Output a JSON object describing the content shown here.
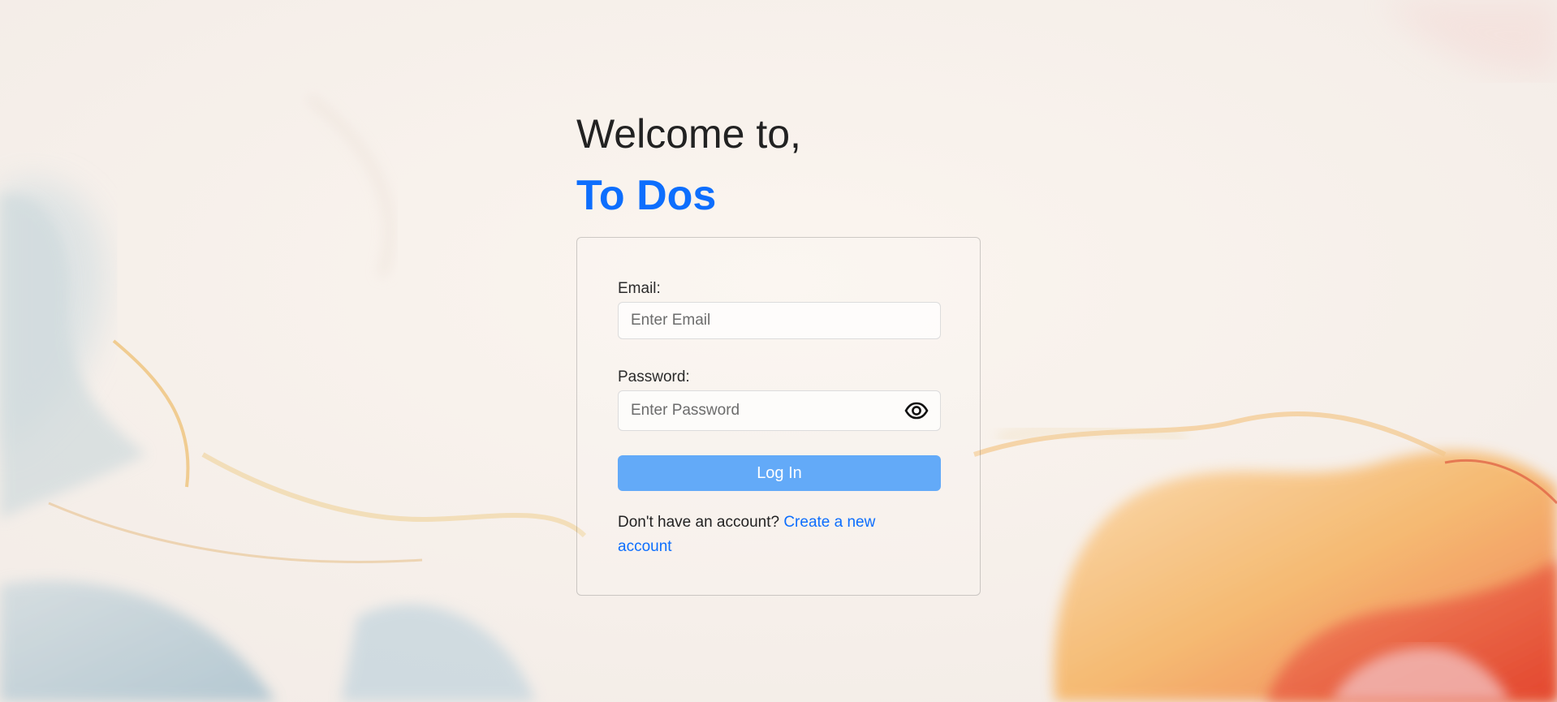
{
  "heading": {
    "welcome": "Welcome to,",
    "app_name": "To Dos"
  },
  "form": {
    "email_label": "Email:",
    "email_placeholder": "Enter Email",
    "email_value": "",
    "password_label": "Password:",
    "password_placeholder": "Enter Password",
    "password_value": "",
    "password_toggle_icon": "eye-icon",
    "login_label": "Log In"
  },
  "signup": {
    "prompt": "Don't have an account?",
    "link_text": "Create a new account"
  },
  "colors": {
    "brand": "#0d6efd",
    "button": "#63aaf8",
    "link": "#0d6efd"
  }
}
